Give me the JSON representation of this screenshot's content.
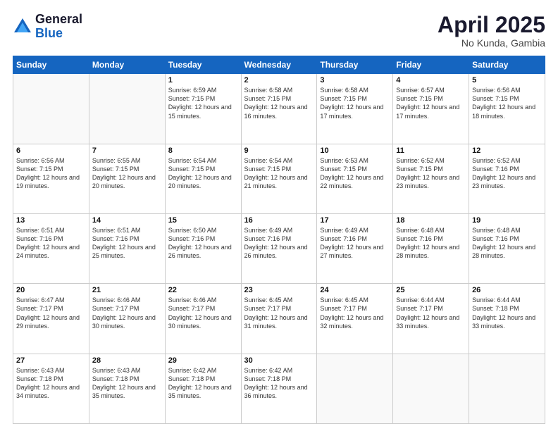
{
  "logo": {
    "general": "General",
    "blue": "Blue"
  },
  "title": "April 2025",
  "location": "No Kunda, Gambia",
  "days_of_week": [
    "Sunday",
    "Monday",
    "Tuesday",
    "Wednesday",
    "Thursday",
    "Friday",
    "Saturday"
  ],
  "weeks": [
    [
      {
        "day": "",
        "empty": true
      },
      {
        "day": "",
        "empty": true
      },
      {
        "day": "1",
        "sunrise": "6:59 AM",
        "sunset": "7:15 PM",
        "daylight": "12 hours and 15 minutes."
      },
      {
        "day": "2",
        "sunrise": "6:58 AM",
        "sunset": "7:15 PM",
        "daylight": "12 hours and 16 minutes."
      },
      {
        "day": "3",
        "sunrise": "6:58 AM",
        "sunset": "7:15 PM",
        "daylight": "12 hours and 17 minutes."
      },
      {
        "day": "4",
        "sunrise": "6:57 AM",
        "sunset": "7:15 PM",
        "daylight": "12 hours and 17 minutes."
      },
      {
        "day": "5",
        "sunrise": "6:56 AM",
        "sunset": "7:15 PM",
        "daylight": "12 hours and 18 minutes."
      }
    ],
    [
      {
        "day": "6",
        "sunrise": "6:56 AM",
        "sunset": "7:15 PM",
        "daylight": "12 hours and 19 minutes."
      },
      {
        "day": "7",
        "sunrise": "6:55 AM",
        "sunset": "7:15 PM",
        "daylight": "12 hours and 20 minutes."
      },
      {
        "day": "8",
        "sunrise": "6:54 AM",
        "sunset": "7:15 PM",
        "daylight": "12 hours and 20 minutes."
      },
      {
        "day": "9",
        "sunrise": "6:54 AM",
        "sunset": "7:15 PM",
        "daylight": "12 hours and 21 minutes."
      },
      {
        "day": "10",
        "sunrise": "6:53 AM",
        "sunset": "7:15 PM",
        "daylight": "12 hours and 22 minutes."
      },
      {
        "day": "11",
        "sunrise": "6:52 AM",
        "sunset": "7:15 PM",
        "daylight": "12 hours and 23 minutes."
      },
      {
        "day": "12",
        "sunrise": "6:52 AM",
        "sunset": "7:16 PM",
        "daylight": "12 hours and 23 minutes."
      }
    ],
    [
      {
        "day": "13",
        "sunrise": "6:51 AM",
        "sunset": "7:16 PM",
        "daylight": "12 hours and 24 minutes."
      },
      {
        "day": "14",
        "sunrise": "6:51 AM",
        "sunset": "7:16 PM",
        "daylight": "12 hours and 25 minutes."
      },
      {
        "day": "15",
        "sunrise": "6:50 AM",
        "sunset": "7:16 PM",
        "daylight": "12 hours and 26 minutes."
      },
      {
        "day": "16",
        "sunrise": "6:49 AM",
        "sunset": "7:16 PM",
        "daylight": "12 hours and 26 minutes."
      },
      {
        "day": "17",
        "sunrise": "6:49 AM",
        "sunset": "7:16 PM",
        "daylight": "12 hours and 27 minutes."
      },
      {
        "day": "18",
        "sunrise": "6:48 AM",
        "sunset": "7:16 PM",
        "daylight": "12 hours and 28 minutes."
      },
      {
        "day": "19",
        "sunrise": "6:48 AM",
        "sunset": "7:16 PM",
        "daylight": "12 hours and 28 minutes."
      }
    ],
    [
      {
        "day": "20",
        "sunrise": "6:47 AM",
        "sunset": "7:17 PM",
        "daylight": "12 hours and 29 minutes."
      },
      {
        "day": "21",
        "sunrise": "6:46 AM",
        "sunset": "7:17 PM",
        "daylight": "12 hours and 30 minutes."
      },
      {
        "day": "22",
        "sunrise": "6:46 AM",
        "sunset": "7:17 PM",
        "daylight": "12 hours and 30 minutes."
      },
      {
        "day": "23",
        "sunrise": "6:45 AM",
        "sunset": "7:17 PM",
        "daylight": "12 hours and 31 minutes."
      },
      {
        "day": "24",
        "sunrise": "6:45 AM",
        "sunset": "7:17 PM",
        "daylight": "12 hours and 32 minutes."
      },
      {
        "day": "25",
        "sunrise": "6:44 AM",
        "sunset": "7:17 PM",
        "daylight": "12 hours and 33 minutes."
      },
      {
        "day": "26",
        "sunrise": "6:44 AM",
        "sunset": "7:18 PM",
        "daylight": "12 hours and 33 minutes."
      }
    ],
    [
      {
        "day": "27",
        "sunrise": "6:43 AM",
        "sunset": "7:18 PM",
        "daylight": "12 hours and 34 minutes."
      },
      {
        "day": "28",
        "sunrise": "6:43 AM",
        "sunset": "7:18 PM",
        "daylight": "12 hours and 35 minutes."
      },
      {
        "day": "29",
        "sunrise": "6:42 AM",
        "sunset": "7:18 PM",
        "daylight": "12 hours and 35 minutes."
      },
      {
        "day": "30",
        "sunrise": "6:42 AM",
        "sunset": "7:18 PM",
        "daylight": "12 hours and 36 minutes."
      },
      {
        "day": "",
        "empty": true
      },
      {
        "day": "",
        "empty": true
      },
      {
        "day": "",
        "empty": true
      }
    ]
  ]
}
